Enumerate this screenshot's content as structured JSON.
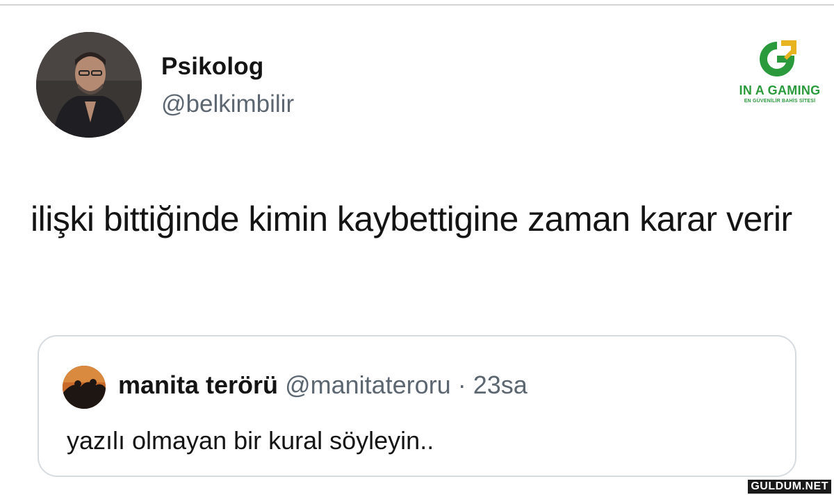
{
  "tweet": {
    "author_name": "Psikolog",
    "author_handle": "@belkimbilir",
    "text": "ilişki bittiğinde kimin kaybettigine zaman karar verir"
  },
  "quoted_tweet": {
    "author_name": "manita terörü",
    "author_handle": "@manitateroru",
    "separator": "·",
    "timestamp": "23sa",
    "text": "yazılı olmayan bir kural söyleyin.."
  },
  "brand_overlay": {
    "name": "IN A GAMING",
    "tagline": "EN GÜVENİLİR BAHİS SİTESİ",
    "icon": "g-logo-icon",
    "colors": {
      "green": "#2a9a3c",
      "gold": "#e8b320"
    }
  },
  "watermark": {
    "text": "GULDUM.NET"
  },
  "colors": {
    "text_primary": "#141414",
    "text_secondary": "#5b6670",
    "card_border": "#d6dbe0"
  }
}
